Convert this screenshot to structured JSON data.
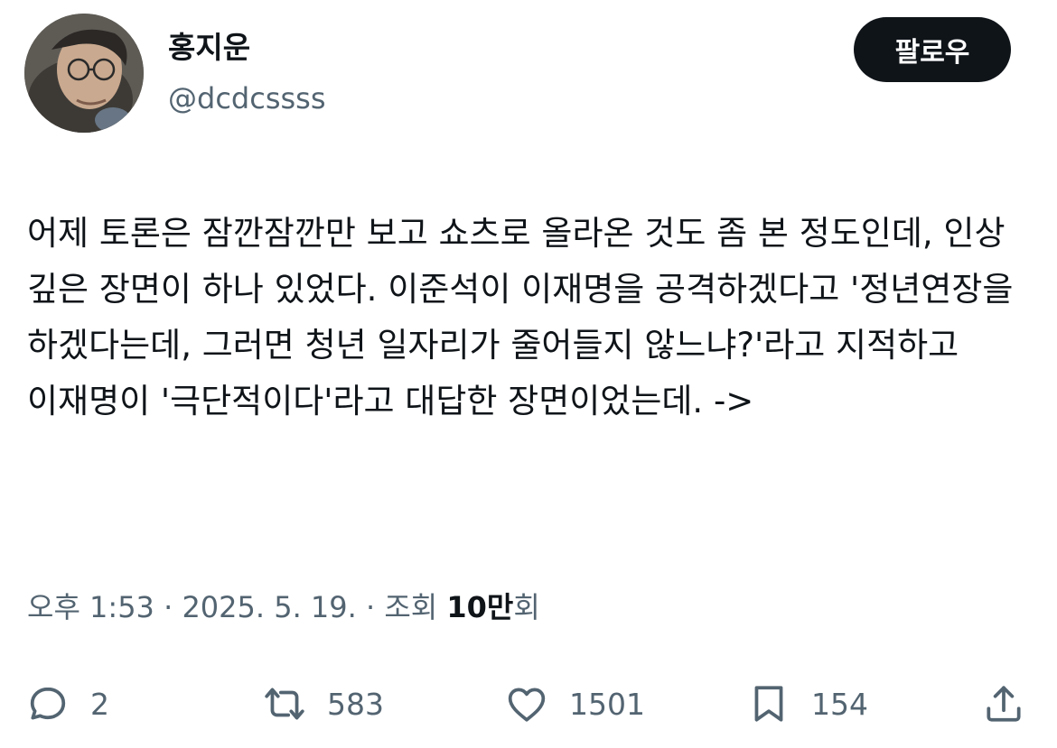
{
  "author": {
    "name": "홍지운",
    "handle": "@dcdcssss"
  },
  "follow_label": "팔로우",
  "tweet_text": "어제 토론은 잠깐잠깐만 보고 쇼츠로 올라온 것도 좀 본 정도인데, 인상 깊은 장면이 하나 있었다. 이준석이 이재명을 공격하겠다고 '정년연장을 하겠다는데, 그러면 청년 일자리가 줄어들지 않느냐?'라고 지적하고 이재명이 '극단적이다'라고 대답한 장면이었는데. ->",
  "meta": {
    "time": "오후 1:53",
    "date": "2025. 5. 19.",
    "separator": "·",
    "views_label": "조회",
    "views_count": "10만",
    "views_suffix": "회"
  },
  "actions": {
    "replies": "2",
    "reposts": "583",
    "likes": "1501",
    "bookmarks": "154"
  },
  "icons": [
    "reply-icon",
    "repost-icon",
    "like-icon",
    "bookmark-icon",
    "share-icon"
  ],
  "colors": {
    "text": "#0f1419",
    "secondary": "#536471",
    "follow_bg": "#0f1419"
  }
}
